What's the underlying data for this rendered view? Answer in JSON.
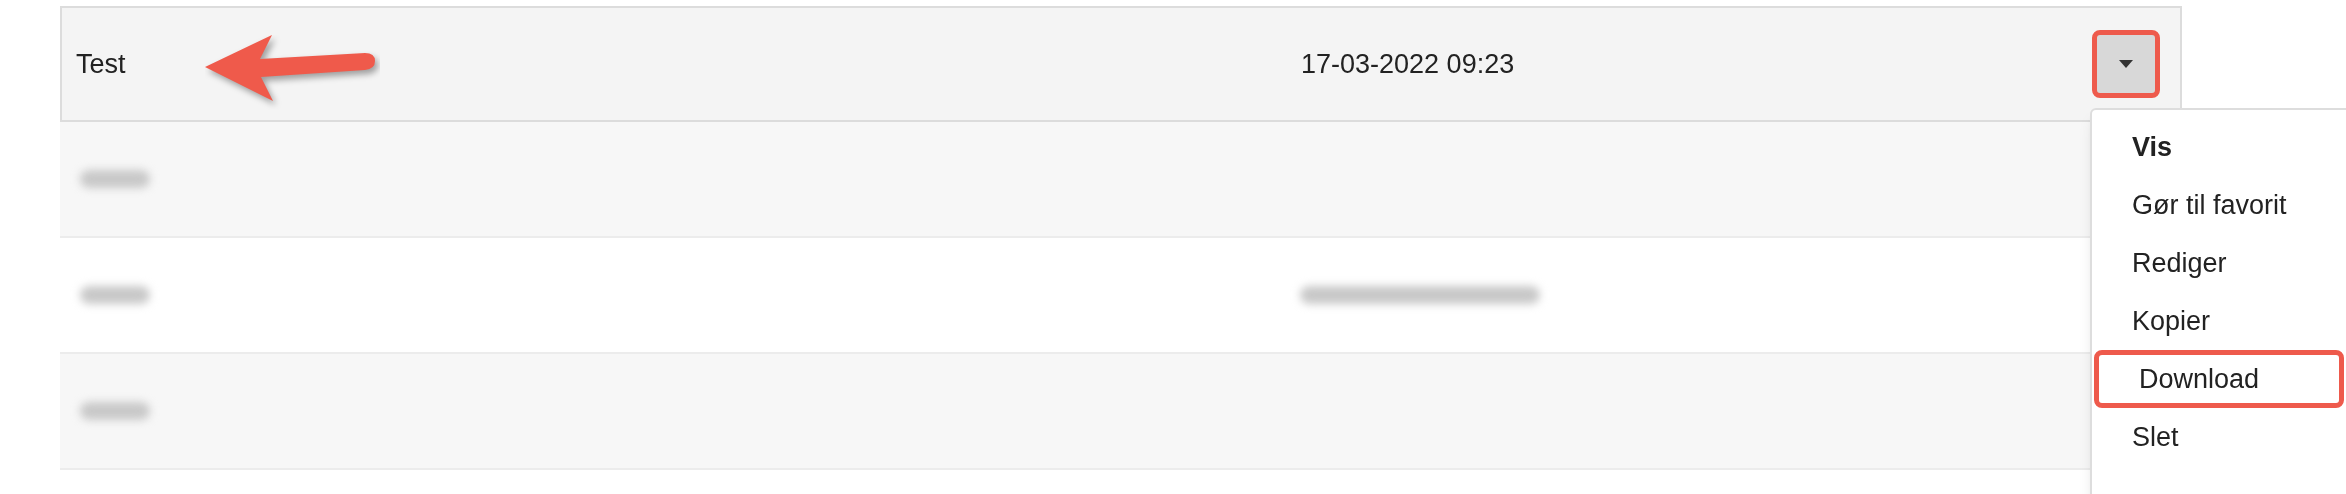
{
  "rows": [
    {
      "kind": "plain",
      "name": "Test",
      "date": "17-03-2022 09:23",
      "menu_open": true
    },
    {
      "kind": "redacted",
      "has_date": false
    },
    {
      "kind": "redacted",
      "has_date": true
    },
    {
      "kind": "redacted",
      "has_date": false
    }
  ],
  "menu": {
    "items": [
      {
        "label": "Vis",
        "default": true,
        "highlighted": false
      },
      {
        "label": "Gør til favorit",
        "default": false,
        "highlighted": false
      },
      {
        "label": "Rediger",
        "default": false,
        "highlighted": false
      },
      {
        "label": "Kopier",
        "default": false,
        "highlighted": false
      },
      {
        "label": "Download",
        "default": false,
        "highlighted": true
      },
      {
        "label": "Slet",
        "default": false,
        "highlighted": false
      }
    ]
  }
}
